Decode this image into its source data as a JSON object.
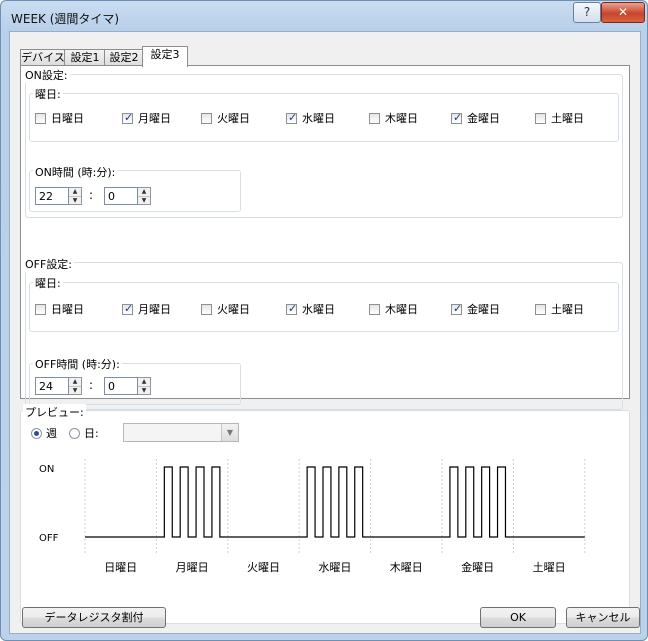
{
  "window": {
    "title": "WEEK (週間タイマ)",
    "help_glyph": "?",
    "close_glyph": "✕"
  },
  "tabs": [
    {
      "label": "デバイス"
    },
    {
      "label": "設定1"
    },
    {
      "label": "設定2"
    },
    {
      "label": "設定3"
    }
  ],
  "on_section": {
    "label": "ON設定:",
    "weekday_label": "曜日:",
    "days": [
      {
        "label": "日曜日",
        "checked": false
      },
      {
        "label": "月曜日",
        "checked": true
      },
      {
        "label": "火曜日",
        "checked": false
      },
      {
        "label": "水曜日",
        "checked": true
      },
      {
        "label": "木曜日",
        "checked": false
      },
      {
        "label": "金曜日",
        "checked": true
      },
      {
        "label": "土曜日",
        "checked": false
      }
    ],
    "time_label": "ON時間 (時:分):",
    "hour": "22",
    "colon": ":",
    "minute": "0"
  },
  "off_section": {
    "label": "OFF設定:",
    "weekday_label": "曜日:",
    "days": [
      {
        "label": "日曜日",
        "checked": false
      },
      {
        "label": "月曜日",
        "checked": true
      },
      {
        "label": "火曜日",
        "checked": false
      },
      {
        "label": "水曜日",
        "checked": true
      },
      {
        "label": "木曜日",
        "checked": false
      },
      {
        "label": "金曜日",
        "checked": true
      },
      {
        "label": "土曜日",
        "checked": false
      }
    ],
    "time_label": "OFF時間 (時:分):",
    "hour": "24",
    "colon": ":",
    "minute": "0"
  },
  "preview": {
    "label": "プレビュー:",
    "radio_week": {
      "label": "週",
      "selected": true
    },
    "radio_day": {
      "label": "日:",
      "selected": false
    },
    "day_select_value": ""
  },
  "chart_data": {
    "type": "line",
    "ylabel_on": "ON",
    "ylabel_off": "OFF",
    "categories": [
      "日曜日",
      "月曜日",
      "火曜日",
      "水曜日",
      "木曜日",
      "金曜日",
      "土曜日"
    ],
    "states": [
      [
        0
      ],
      [
        0,
        1,
        0,
        1,
        0,
        1,
        0,
        1,
        0
      ],
      [
        0
      ],
      [
        0,
        1,
        0,
        1,
        0,
        1,
        0,
        1,
        0
      ],
      [
        0
      ],
      [
        0,
        1,
        0,
        1,
        0,
        1,
        0,
        1,
        0
      ],
      [
        0
      ]
    ]
  },
  "buttons": {
    "data_register": "データレジスタ割付",
    "ok": "OK",
    "cancel": "キャンセル"
  },
  "colors": {
    "accent": "#2b4f8c",
    "title_bar": "#bcd2ea",
    "close": "#c8452b"
  }
}
